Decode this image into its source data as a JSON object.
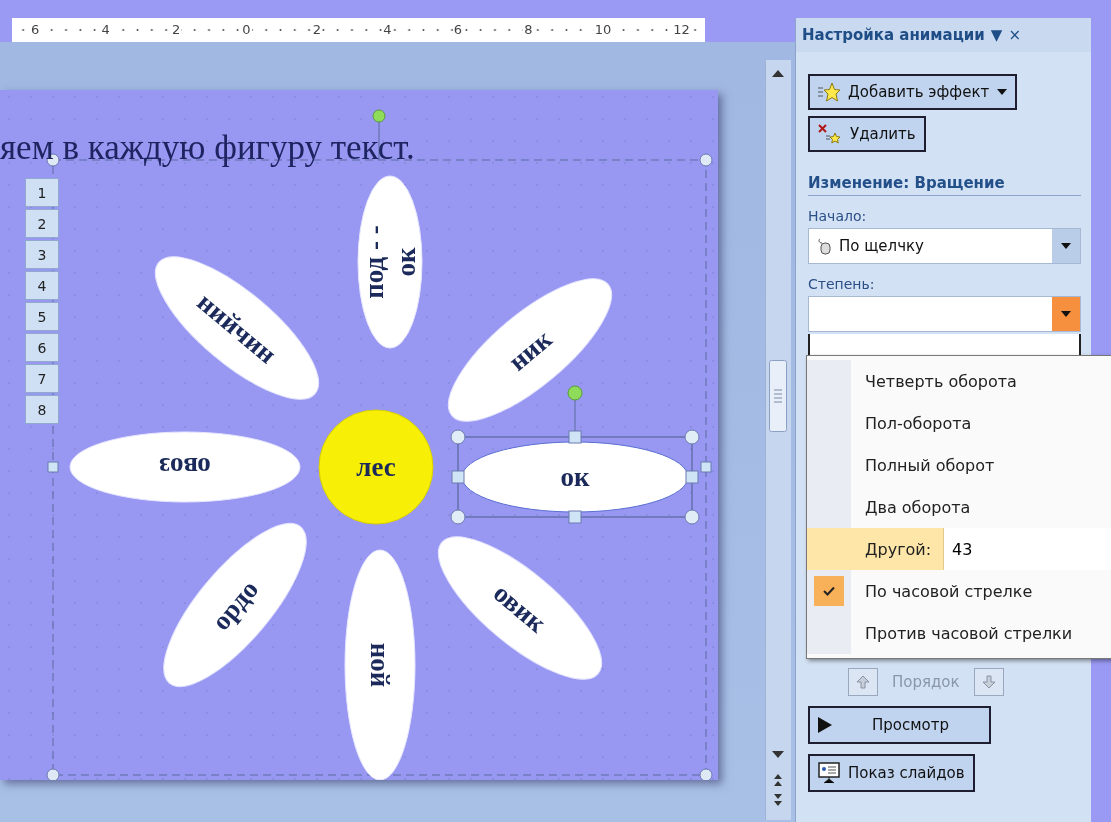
{
  "ruler": {
    "labels": [
      "6",
      "4",
      "2",
      "0",
      "2",
      "4",
      "6",
      "8",
      "10",
      "12"
    ]
  },
  "slide": {
    "title": "яем в каждую фигуру текст.",
    "order_tags": [
      "1",
      "2",
      "3",
      "4",
      "5",
      "6",
      "7",
      "8"
    ],
    "center": {
      "text": "лес"
    },
    "petals": [
      {
        "lines": [
          "под - -",
          "ок"
        ],
        "selected": false
      },
      {
        "lines": [
          "ник"
        ],
        "selected": false
      },
      {
        "lines": [
          "ок"
        ],
        "selected": true
      },
      {
        "lines": [
          "овик"
        ],
        "selected": false
      },
      {
        "lines": [
          "ной"
        ],
        "selected": false
      },
      {
        "lines": [
          "ордо"
        ],
        "selected": false
      },
      {
        "lines": [
          "овоз"
        ],
        "selected": false
      },
      {
        "lines": [
          "нийчин"
        ],
        "selected": false
      }
    ]
  },
  "pane": {
    "title": "Настройка анимации",
    "menu_glyph": "▼",
    "close_glyph": "×",
    "add_button": "Добавить эффект",
    "delete_button": "Удалить",
    "section": "Изменение: Вращение",
    "start": {
      "label": "Начало:",
      "value": "По щелчку",
      "open": false
    },
    "degree": {
      "label": "Степень:",
      "open": true
    },
    "menu": [
      {
        "kind": "item",
        "label": "Четверть оборота",
        "selected": false
      },
      {
        "kind": "item",
        "label": "Пол-оборота",
        "selected": false
      },
      {
        "kind": "item",
        "label": "Полный оборот",
        "selected": false
      },
      {
        "kind": "item",
        "label": "Два оборота",
        "selected": false
      },
      {
        "kind": "input",
        "label": "Другой:",
        "value": "43",
        "selected": true
      },
      {
        "kind": "check",
        "label": "По часовой стрелке",
        "selected": false,
        "checked": true
      },
      {
        "kind": "check",
        "label": "Против часовой стрелки",
        "selected": false,
        "checked": false
      }
    ],
    "order": {
      "label": "Порядок",
      "disabled": true
    },
    "preview_button": "Просмотр",
    "slideshow_button": "Показ слайдов"
  }
}
